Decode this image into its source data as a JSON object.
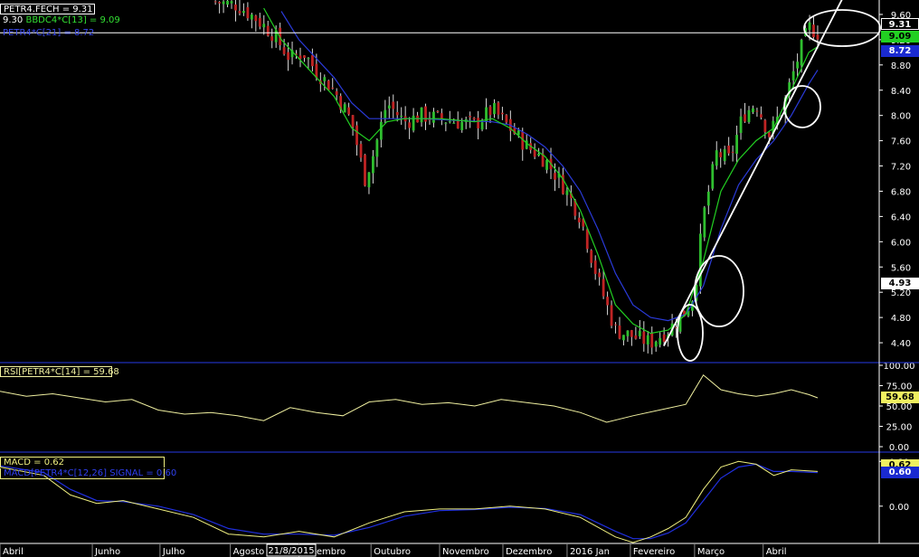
{
  "colors": {
    "background": "#000000",
    "axis": "#ffffff",
    "grid": "#1a1a1a",
    "separator": "#1f2fb8",
    "up_candle": "#2fbf2f",
    "down_candle": "#c02424",
    "ma_green": "#22d022",
    "ma_blue": "#2a3ad8",
    "rsi": "#f0f0a0",
    "macd": "#f0f080",
    "signal": "#2030e0",
    "annotation": "#ffffff"
  },
  "legends": {
    "price_line1": "PETR4.FECH = 9.31",
    "price_line2_prefix": "9.30",
    "price_line2": "BBDC4*C[13] = 9.09",
    "price_line3": "PETR4*C[21] = 8.72",
    "rsi": "RSI[PETR4*C[14] = 59.68",
    "macd": "MACD = 0.62",
    "signal": "MACD[PETR4*C[12,26] SIGNAL = 0.60"
  },
  "badges": {
    "close": "9.31",
    "ma_green": "9.09",
    "ma_blue": "8.72",
    "marker": "4.93",
    "rsi": "59.68",
    "macd": "0.62",
    "signal": "0.60"
  },
  "chart_data": [
    {
      "type": "candlestick",
      "title": "",
      "price_ticks": [
        "9.60",
        "9.20",
        "8.80",
        "8.40",
        "8.00",
        "7.60",
        "7.20",
        "6.80",
        "6.40",
        "6.00",
        "5.60",
        "5.20",
        "4.80",
        "4.40"
      ],
      "ylim": [
        4.1,
        9.8
      ],
      "grid": false,
      "x_ticks": [
        "Abril",
        "Junho",
        "Julho",
        "Agosto",
        "Setembro",
        "Outubro",
        "Novembro",
        "Dezembro",
        "2016 Jan",
        "Fevereiro",
        "Março",
        "Abril"
      ],
      "cursor_date": "21/8/2015",
      "close_path": [
        [
          0.245,
          9.8
        ],
        [
          0.27,
          9.75
        ],
        [
          0.29,
          9.55
        ],
        [
          0.31,
          9.3
        ],
        [
          0.33,
          8.9
        ],
        [
          0.345,
          9.0
        ],
        [
          0.36,
          8.7
        ],
        [
          0.38,
          8.4
        ],
        [
          0.4,
          7.9
        ],
        [
          0.415,
          7.0
        ],
        [
          0.425,
          7.4
        ],
        [
          0.44,
          8.2
        ],
        [
          0.46,
          7.9
        ],
        [
          0.48,
          8.0
        ],
        [
          0.5,
          7.95
        ],
        [
          0.52,
          7.9
        ],
        [
          0.54,
          7.85
        ],
        [
          0.56,
          8.1
        ],
        [
          0.58,
          7.8
        ],
        [
          0.6,
          7.5
        ],
        [
          0.62,
          7.3
        ],
        [
          0.64,
          6.9
        ],
        [
          0.66,
          6.4
        ],
        [
          0.68,
          5.4
        ],
        [
          0.7,
          4.6
        ],
        [
          0.72,
          4.5
        ],
        [
          0.74,
          4.4
        ],
        [
          0.76,
          4.6
        ],
        [
          0.78,
          4.9
        ],
        [
          0.79,
          5.2
        ],
        [
          0.8,
          6.4
        ],
        [
          0.815,
          7.4
        ],
        [
          0.83,
          7.3
        ],
        [
          0.845,
          8.0
        ],
        [
          0.86,
          8.2
        ],
        [
          0.875,
          7.7
        ],
        [
          0.89,
          8.1
        ],
        [
          0.905,
          8.8
        ],
        [
          0.92,
          9.4
        ],
        [
          0.93,
          9.31
        ]
      ],
      "ma_green_path": [
        [
          0.3,
          9.7
        ],
        [
          0.32,
          9.2
        ],
        [
          0.34,
          8.9
        ],
        [
          0.36,
          8.6
        ],
        [
          0.38,
          8.3
        ],
        [
          0.4,
          7.8
        ],
        [
          0.42,
          7.6
        ],
        [
          0.44,
          7.9
        ],
        [
          0.46,
          7.95
        ],
        [
          0.5,
          7.95
        ],
        [
          0.54,
          7.9
        ],
        [
          0.56,
          7.95
        ],
        [
          0.58,
          7.8
        ],
        [
          0.6,
          7.55
        ],
        [
          0.62,
          7.35
        ],
        [
          0.64,
          7.0
        ],
        [
          0.66,
          6.5
        ],
        [
          0.68,
          5.8
        ],
        [
          0.7,
          5.0
        ],
        [
          0.72,
          4.7
        ],
        [
          0.74,
          4.55
        ],
        [
          0.76,
          4.6
        ],
        [
          0.78,
          4.85
        ],
        [
          0.8,
          5.7
        ],
        [
          0.82,
          6.8
        ],
        [
          0.84,
          7.3
        ],
        [
          0.86,
          7.6
        ],
        [
          0.88,
          7.8
        ],
        [
          0.9,
          8.4
        ],
        [
          0.92,
          9.0
        ],
        [
          0.93,
          9.09
        ]
      ],
      "ma_blue_path": [
        [
          0.32,
          9.65
        ],
        [
          0.34,
          9.2
        ],
        [
          0.36,
          8.9
        ],
        [
          0.38,
          8.6
        ],
        [
          0.4,
          8.2
        ],
        [
          0.42,
          7.95
        ],
        [
          0.44,
          7.95
        ],
        [
          0.48,
          7.95
        ],
        [
          0.52,
          7.92
        ],
        [
          0.56,
          7.9
        ],
        [
          0.58,
          7.85
        ],
        [
          0.6,
          7.7
        ],
        [
          0.62,
          7.5
        ],
        [
          0.64,
          7.2
        ],
        [
          0.66,
          6.8
        ],
        [
          0.68,
          6.2
        ],
        [
          0.7,
          5.5
        ],
        [
          0.72,
          5.0
        ],
        [
          0.74,
          4.8
        ],
        [
          0.76,
          4.75
        ],
        [
          0.78,
          4.85
        ],
        [
          0.8,
          5.3
        ],
        [
          0.82,
          6.2
        ],
        [
          0.84,
          6.9
        ],
        [
          0.86,
          7.3
        ],
        [
          0.88,
          7.6
        ],
        [
          0.9,
          8.0
        ],
        [
          0.92,
          8.5
        ],
        [
          0.93,
          8.72
        ]
      ]
    },
    {
      "type": "line",
      "title": "",
      "y_ticks": [
        "100.00",
        "75.00",
        "50.00",
        "25.00",
        "0.00"
      ],
      "ylim": [
        0,
        100
      ],
      "values": [
        [
          0.0,
          68
        ],
        [
          0.03,
          62
        ],
        [
          0.06,
          65
        ],
        [
          0.09,
          60
        ],
        [
          0.12,
          55
        ],
        [
          0.15,
          58
        ],
        [
          0.18,
          45
        ],
        [
          0.21,
          40
        ],
        [
          0.24,
          42
        ],
        [
          0.27,
          38
        ],
        [
          0.3,
          32
        ],
        [
          0.33,
          48
        ],
        [
          0.36,
          42
        ],
        [
          0.39,
          38
        ],
        [
          0.42,
          55
        ],
        [
          0.45,
          58
        ],
        [
          0.48,
          52
        ],
        [
          0.51,
          54
        ],
        [
          0.54,
          50
        ],
        [
          0.57,
          58
        ],
        [
          0.6,
          54
        ],
        [
          0.63,
          50
        ],
        [
          0.66,
          42
        ],
        [
          0.69,
          30
        ],
        [
          0.72,
          38
        ],
        [
          0.75,
          45
        ],
        [
          0.78,
          52
        ],
        [
          0.8,
          88
        ],
        [
          0.82,
          70
        ],
        [
          0.84,
          65
        ],
        [
          0.86,
          62
        ],
        [
          0.88,
          65
        ],
        [
          0.9,
          70
        ],
        [
          0.92,
          64
        ],
        [
          0.93,
          60
        ]
      ]
    },
    {
      "type": "line",
      "title": "",
      "y_ticks": [
        "0.80",
        "0.00"
      ],
      "ylim": [
        -0.65,
        0.95
      ],
      "series": [
        {
          "name": "MACD",
          "values": [
            [
              0.0,
              0.7
            ],
            [
              0.05,
              0.55
            ],
            [
              0.08,
              0.2
            ],
            [
              0.11,
              0.05
            ],
            [
              0.14,
              0.1
            ],
            [
              0.18,
              -0.05
            ],
            [
              0.22,
              -0.2
            ],
            [
              0.26,
              -0.5
            ],
            [
              0.3,
              -0.55
            ],
            [
              0.34,
              -0.45
            ],
            [
              0.38,
              -0.55
            ],
            [
              0.42,
              -0.3
            ],
            [
              0.46,
              -0.1
            ],
            [
              0.5,
              -0.05
            ],
            [
              0.54,
              -0.05
            ],
            [
              0.58,
              0.0
            ],
            [
              0.62,
              -0.05
            ],
            [
              0.66,
              -0.2
            ],
            [
              0.7,
              -0.55
            ],
            [
              0.72,
              -0.65
            ],
            [
              0.74,
              -0.55
            ],
            [
              0.76,
              -0.4
            ],
            [
              0.78,
              -0.2
            ],
            [
              0.8,
              0.3
            ],
            [
              0.82,
              0.7
            ],
            [
              0.84,
              0.8
            ],
            [
              0.86,
              0.75
            ],
            [
              0.88,
              0.55
            ],
            [
              0.9,
              0.65
            ],
            [
              0.93,
              0.62
            ]
          ]
        },
        {
          "name": "SIGNAL",
          "values": [
            [
              0.0,
              0.72
            ],
            [
              0.05,
              0.6
            ],
            [
              0.08,
              0.3
            ],
            [
              0.11,
              0.1
            ],
            [
              0.14,
              0.08
            ],
            [
              0.18,
              0.0
            ],
            [
              0.22,
              -0.15
            ],
            [
              0.26,
              -0.4
            ],
            [
              0.3,
              -0.5
            ],
            [
              0.34,
              -0.5
            ],
            [
              0.38,
              -0.52
            ],
            [
              0.42,
              -0.38
            ],
            [
              0.46,
              -0.18
            ],
            [
              0.5,
              -0.08
            ],
            [
              0.54,
              -0.06
            ],
            [
              0.58,
              -0.02
            ],
            [
              0.62,
              -0.04
            ],
            [
              0.66,
              -0.15
            ],
            [
              0.7,
              -0.45
            ],
            [
              0.72,
              -0.58
            ],
            [
              0.74,
              -0.58
            ],
            [
              0.76,
              -0.48
            ],
            [
              0.78,
              -0.3
            ],
            [
              0.8,
              0.1
            ],
            [
              0.82,
              0.5
            ],
            [
              0.84,
              0.7
            ],
            [
              0.86,
              0.75
            ],
            [
              0.88,
              0.62
            ],
            [
              0.9,
              0.62
            ],
            [
              0.93,
              0.6
            ]
          ]
        }
      ]
    }
  ]
}
